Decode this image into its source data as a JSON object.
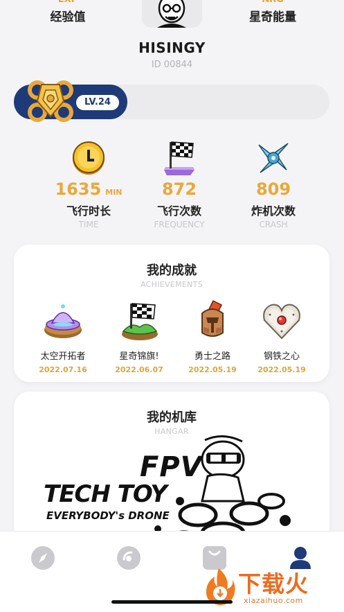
{
  "header": {
    "exp": {
      "abbr": "EXP",
      "label": "经验值"
    },
    "nrg": {
      "abbr": "NRG",
      "label": "星奇能量"
    }
  },
  "user": {
    "name": "HISINGY",
    "id": "ID 00844",
    "level": "LV.24",
    "level_progress": 0.36
  },
  "flight_stats": [
    {
      "value": "1635",
      "unit": "MIN",
      "label_cn": "飞行时长",
      "label_en": "TIME",
      "icon": "clock-coin-icon"
    },
    {
      "value": "872",
      "unit": "",
      "label_cn": "飞行次数",
      "label_en": "FREQUENCY",
      "icon": "checkered-flag-icon"
    },
    {
      "value": "809",
      "unit": "",
      "label_cn": "炸机次数",
      "label_en": "CRASH",
      "icon": "crashed-drone-icon"
    }
  ],
  "achievements": {
    "title": "我的成就",
    "subtitle": "ACHIEVEMENTS",
    "items": [
      {
        "name": "太空开拓者",
        "date": "2022.07.16",
        "icon": "ufo-icon"
      },
      {
        "name": "星奇锦旗!",
        "date": "2022.06.07",
        "icon": "flag-island-icon"
      },
      {
        "name": "勇士之路",
        "date": "2022.05.19",
        "icon": "warrior-helmet-icon"
      },
      {
        "name": "钢铁之心",
        "date": "2022.05.19",
        "icon": "iron-heart-icon"
      }
    ]
  },
  "hangar": {
    "title": "我的机库",
    "subtitle": "HANGAR",
    "art_line1": "FPV",
    "art_line2": "TECH TOY",
    "art_line3": "EVERYBODY's DRONE"
  },
  "nav": [
    {
      "name": "explore",
      "icon": "compass-icon"
    },
    {
      "name": "discover",
      "icon": "disc-icon"
    },
    {
      "name": "shop",
      "icon": "shopping-bag-icon"
    },
    {
      "name": "profile",
      "icon": "person-icon",
      "active": true
    }
  ],
  "watermark": {
    "text_cn": "下载火",
    "url": "xiazaihuo.com"
  },
  "colors": {
    "accent": "#e9a83a",
    "level_bar": "#1e3a78",
    "nav_active": "#1e3a78",
    "nav_inactive": "#c9c9ce"
  }
}
